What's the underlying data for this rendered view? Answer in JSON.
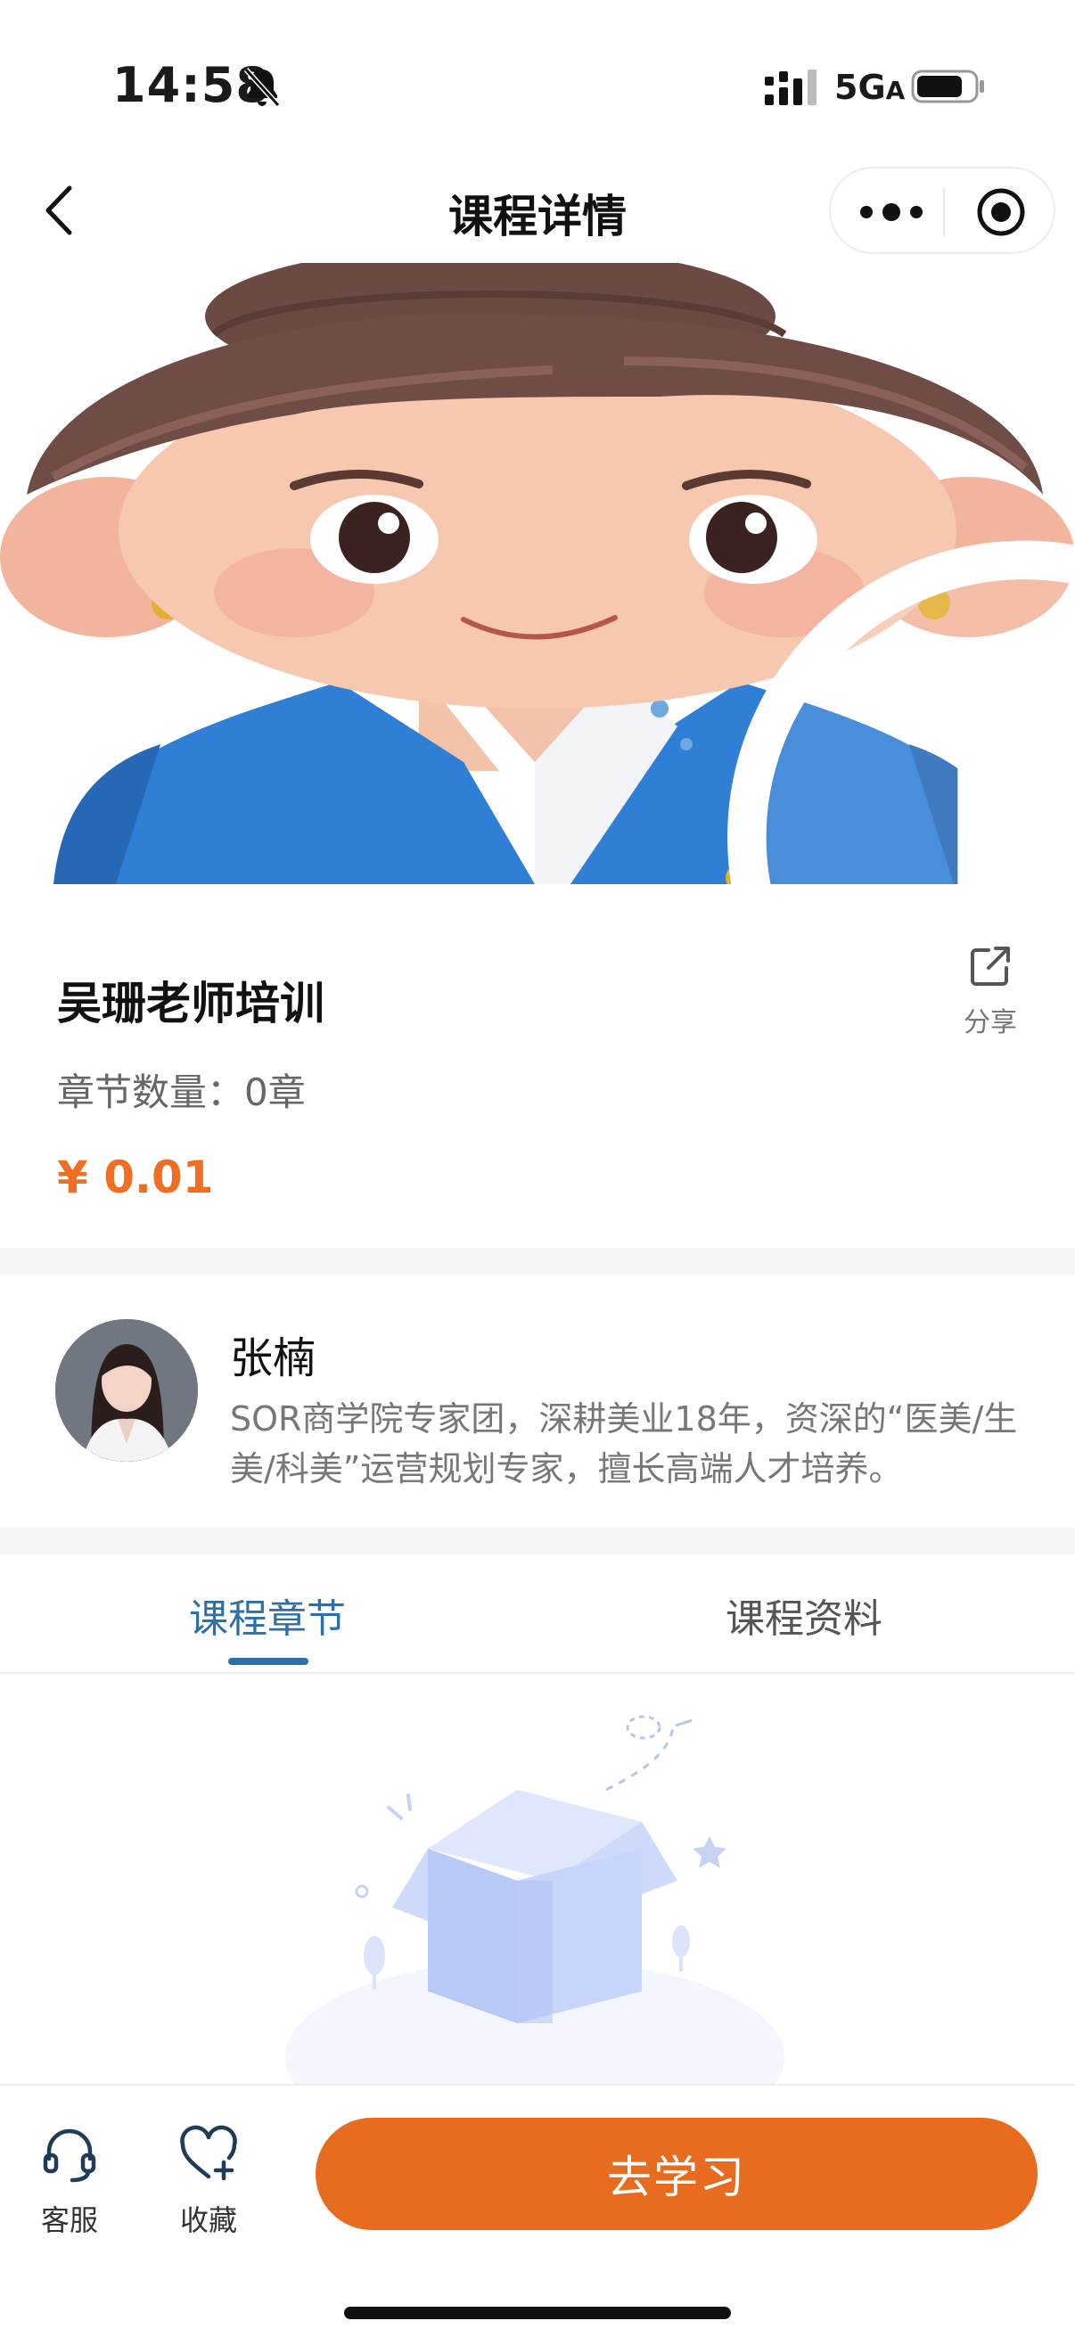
{
  "status_bar": {
    "time": "14:58",
    "network": "5G",
    "network_suffix": "A"
  },
  "nav": {
    "title": "课程详情"
  },
  "course": {
    "title": "吴珊老师培训",
    "chapter_count": "章节数量：0章",
    "price": "¥ 0.01",
    "share_label": "分享"
  },
  "teacher": {
    "name": "张楠",
    "description": "SOR商学院专家团，深耕美业18年，资深的“医美/生美/科美”运营规划专家，擅长高端人才培养。"
  },
  "tabs": [
    {
      "label": "课程章节",
      "active": true
    },
    {
      "label": "课程资料",
      "active": false
    }
  ],
  "bottom_bar": {
    "service_label": "客服",
    "favorite_label": "收藏",
    "learn_button": "去学习"
  },
  "colors": {
    "accent": "#e86c1f",
    "price": "#ee6f22",
    "tab_active": "#2e6fa8"
  },
  "icons": [
    "bell-muted-icon",
    "signal-icon",
    "battery-icon",
    "back-icon",
    "more-icon",
    "target-icon",
    "play-icon",
    "share-icon",
    "headset-icon",
    "heart-plus-icon"
  ]
}
